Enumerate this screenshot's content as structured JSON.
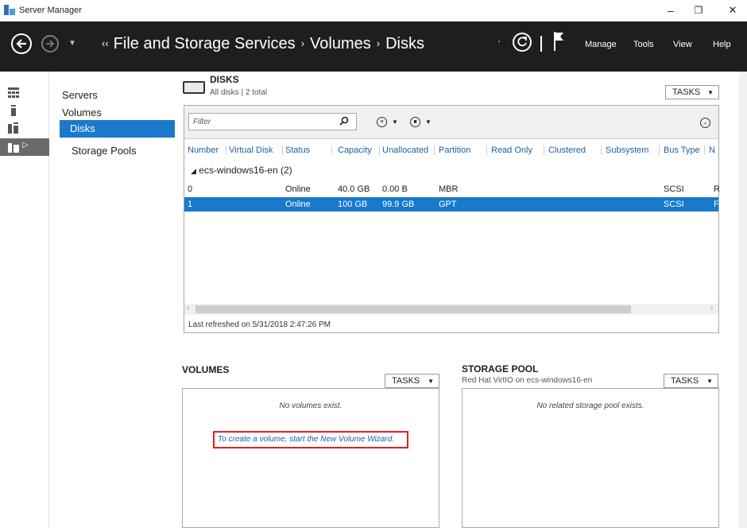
{
  "window": {
    "title": "Server Manager",
    "minimize": "–",
    "restore": "❐",
    "close": "✕"
  },
  "topbar": {
    "breadcrumb_lead": "‹‹",
    "breadcrumb": [
      "File and Storage Services",
      "Volumes",
      "Disks"
    ],
    "breadcrumb_sep": "›",
    "refresh_drop": "·",
    "menu": [
      "Manage",
      "Tools",
      "View",
      "Help"
    ]
  },
  "subnav": {
    "items": [
      "Servers",
      "Volumes",
      "Disks",
      "Storage Pools"
    ],
    "selected": "Disks"
  },
  "disks": {
    "title": "DISKS",
    "subtitle": "All disks | 2 total",
    "tasks": "TASKS",
    "filter_placeholder": "Filter",
    "columns": [
      "Number",
      "Virtual Disk",
      "Status",
      "Capacity",
      "Unallocated",
      "Partition",
      "Read Only",
      "Clustered",
      "Subsystem",
      "Bus Type",
      "N"
    ],
    "group": "ecs-windows16-en (2)",
    "rows": [
      {
        "number": "0",
        "status": "Online",
        "capacity": "40.0 GB",
        "unallocated": "0.00 B",
        "partition": "MBR",
        "bus": "SCSI",
        "n": "R"
      },
      {
        "number": "1",
        "status": "Online",
        "capacity": "100 GB",
        "unallocated": "99.9 GB",
        "partition": "GPT",
        "bus": "SCSI",
        "n": "F"
      }
    ],
    "refreshed": "Last refreshed on 5/31/2018 2:47:26 PM"
  },
  "volumes": {
    "title": "VOLUMES",
    "tasks": "TASKS",
    "empty": "No volumes exist.",
    "wizard_link": "To create a volume, start the New Volume Wizard."
  },
  "storage_pool": {
    "title": "STORAGE POOL",
    "subtitle": "Red Hat VirtIO on ecs-windows16-en",
    "tasks": "TASKS",
    "empty": "No related storage pool exists."
  },
  "colors": {
    "accent": "#1979ca",
    "topbar": "#1e1e1e",
    "link": "#1f5f9f",
    "highlight": "#e02020"
  }
}
